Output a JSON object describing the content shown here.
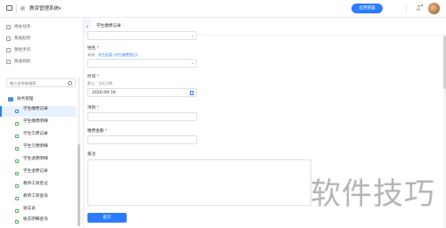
{
  "header": {
    "system_name": "教资管理系统",
    "app_button": "应用管理"
  },
  "sidebar": {
    "links": [
      {
        "label": "待办任务"
      },
      {
        "label": "我发起的"
      },
      {
        "label": "我经手的"
      },
      {
        "label": "我收到的"
      }
    ],
    "search_placeholder": "输入名称来搜索",
    "group_label": "财务管理",
    "items": [
      {
        "label": "学生缴费记录",
        "active": true
      },
      {
        "label": "学生缴费明细",
        "active": false
      },
      {
        "label": "学生欠费记录",
        "active": false
      },
      {
        "label": "学生欠费明细",
        "active": false
      },
      {
        "label": "学生退费明细",
        "active": false
      },
      {
        "label": "学生退费记录",
        "active": false
      },
      {
        "label": "教师工资登记",
        "active": false
      },
      {
        "label": "教师工资查询",
        "active": false
      },
      {
        "label": "收支表",
        "active": false
      },
      {
        "label": "收支明细查询",
        "active": false
      }
    ]
  },
  "tab": {
    "label": "学生缴费记录"
  },
  "form": {
    "field1_label": "姓名",
    "field1_source_prefix": "来源：",
    "field1_source_link": "学生档案 (学生缴费登记)",
    "date_label": "时间",
    "date_hint": "默认：当天日期",
    "date_value": "2020-09-16",
    "project_label": "项目",
    "amount_label": "缴费金额",
    "remark_label": "备注",
    "submit_label": "提交"
  },
  "watermark": "软件技巧",
  "colors": {
    "accent": "#2b7cff",
    "required": "#f5222d",
    "menu_icon": "#44b549"
  }
}
